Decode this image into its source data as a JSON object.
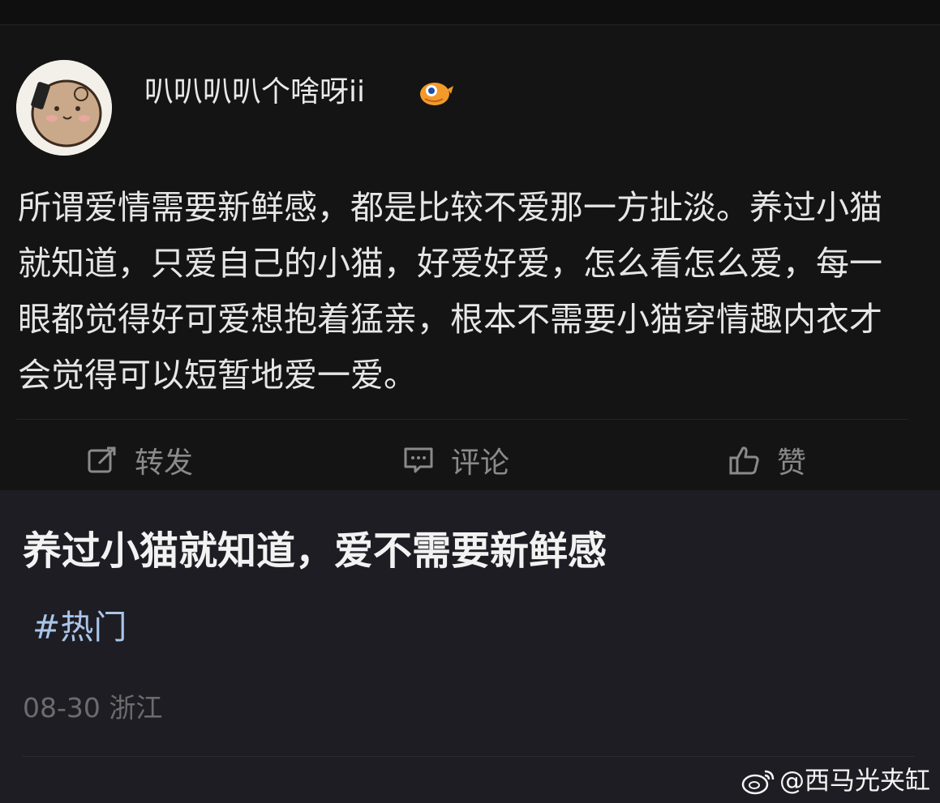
{
  "post": {
    "username": "叭叭叭叭个啥呀ii",
    "username_emoji": "orange-bird-emoji-icon",
    "body": "所谓爱情需要新鲜感，都是比较不爱那一方扯淡。养过小猫就知道，只爱自己的小猫，好爱好爱，怎么看怎么爱，每一眼都觉得好可爱想抱着猛亲，根本不需要小猫穿情趣内衣才会觉得可以短暂地爱一爱。"
  },
  "actions": {
    "repost_label": "转发",
    "comment_label": "评论",
    "like_label": "赞"
  },
  "article": {
    "headline": "养过小猫就知道，爱不需要新鲜感",
    "topic": "#热门",
    "date": "08-30",
    "location": "浙江"
  },
  "watermark": {
    "text": "@西马光夹缸",
    "icon": "weibo-logo-icon"
  },
  "colors": {
    "card_bg": "#141414",
    "page_bg": "#1e1d23",
    "topic_link": "#a9c6ea",
    "muted_text": "#8a8a8a"
  }
}
